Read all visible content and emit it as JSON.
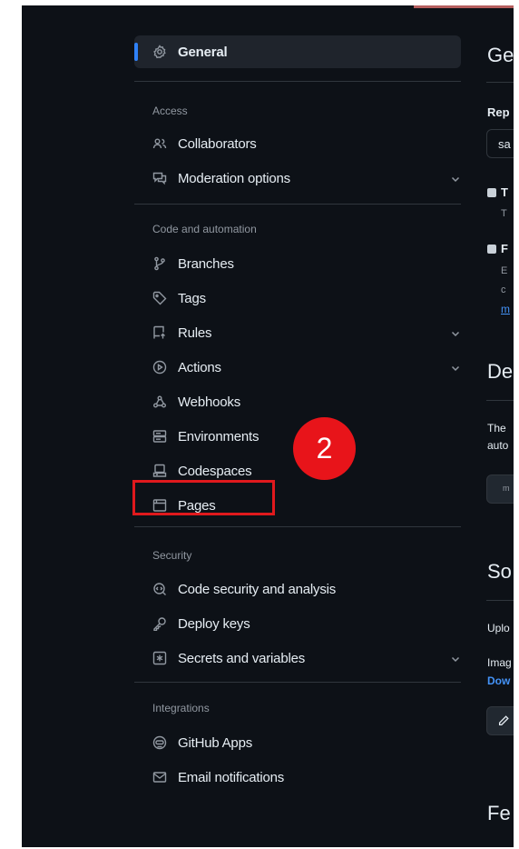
{
  "sidebar": {
    "general": "General",
    "sections": {
      "access": "Access",
      "code_automation": "Code and automation",
      "security": "Security",
      "integrations": "Integrations"
    },
    "items": {
      "collaborators": "Collaborators",
      "moderation": "Moderation options",
      "branches": "Branches",
      "tags": "Tags",
      "rules": "Rules",
      "actions": "Actions",
      "webhooks": "Webhooks",
      "environments": "Environments",
      "codespaces": "Codespaces",
      "pages": "Pages",
      "code_security": "Code security and analysis",
      "deploy_keys": "Deploy keys",
      "secrets": "Secrets and variables",
      "github_apps": "GitHub Apps",
      "email_notifications": "Email notifications"
    }
  },
  "annotation": {
    "step_number": "2"
  },
  "content": {
    "heading_general": "Ge",
    "repo_label": "Rep",
    "repo_input_value": "sa",
    "template_bold": "T",
    "template_desc": "T",
    "feature_bold": "F",
    "feature_desc_1": "E",
    "feature_desc_2": "c",
    "feature_link": "m",
    "heading_default": "De",
    "default_desc_1": "The",
    "default_desc_2": "auto",
    "default_btn_text": "m",
    "heading_social": "So",
    "social_upload": "Uplo",
    "social_image": "Imag",
    "social_download": "Dow",
    "heading_features": "Fe"
  },
  "colors": {
    "background": "#0d1117",
    "accent_blue": "#2f81f7",
    "annotation_red": "#e8141a"
  }
}
